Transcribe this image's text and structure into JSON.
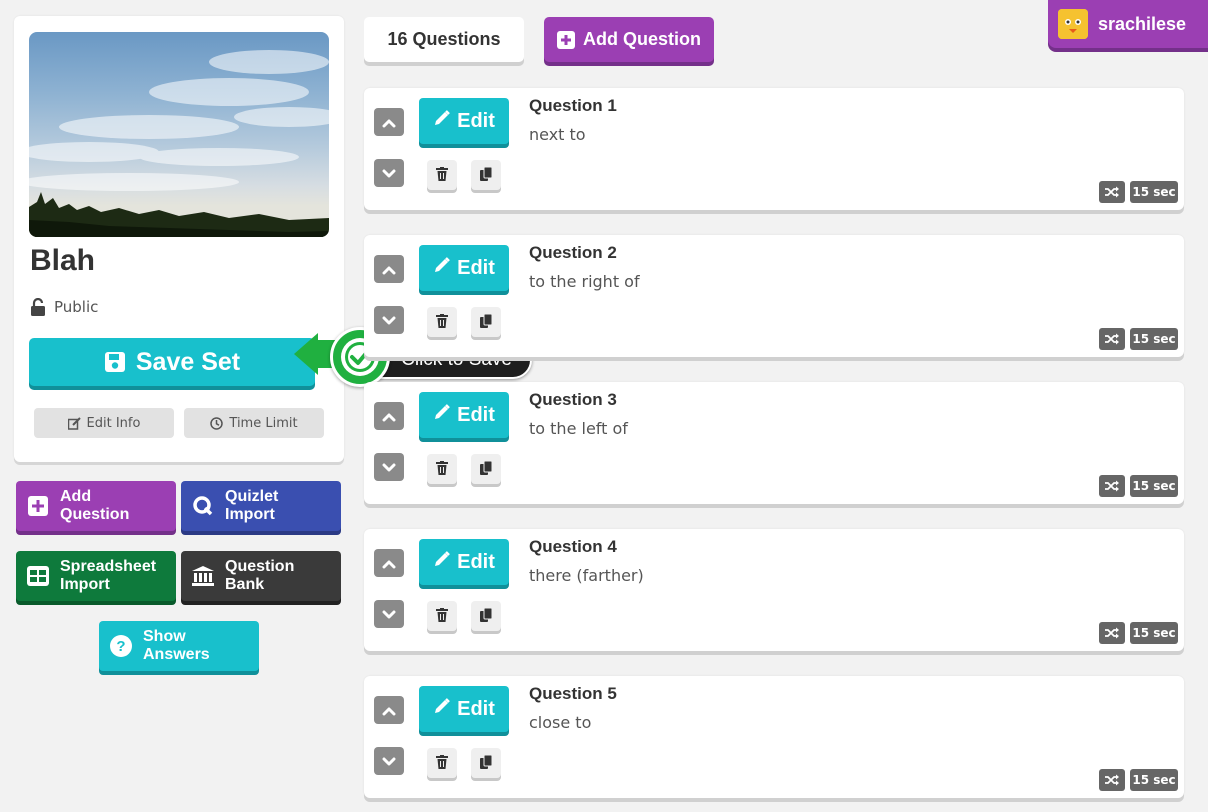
{
  "set": {
    "title": "Blah",
    "visibility": "Public",
    "save_label": "Save Set",
    "edit_info_label": "Edit Info",
    "time_limit_label": "Time Limit"
  },
  "tooltip": {
    "text": "Click to Save"
  },
  "actions": {
    "add_question": [
      "Add",
      "Question"
    ],
    "quizlet_import": [
      "Quizlet",
      "Import"
    ],
    "spreadsheet_import": [
      "Spreadsheet",
      "Import"
    ],
    "question_bank": [
      "Question",
      "Bank"
    ],
    "show_answers": [
      "Show",
      "Answers"
    ]
  },
  "topbar": {
    "count_label": "16 Questions",
    "add_question_label": "Add Question"
  },
  "user": {
    "name": "srachilese"
  },
  "questions": [
    {
      "title": "Question 1",
      "answer": "next to",
      "edit_label": "Edit",
      "time": "15 sec"
    },
    {
      "title": "Question 2",
      "answer": "to the right of",
      "edit_label": "Edit",
      "time": "15 sec"
    },
    {
      "title": "Question 3",
      "answer": "to the left of",
      "edit_label": "Edit",
      "time": "15 sec"
    },
    {
      "title": "Question 4",
      "answer": "there (farther)",
      "edit_label": "Edit",
      "time": "15 sec"
    },
    {
      "title": "Question 5",
      "answer": "close to",
      "edit_label": "Edit",
      "time": "15 sec"
    }
  ],
  "colors": {
    "teal": "#18c0cc",
    "purple": "#9b3fb3",
    "blue": "#3a4fb0",
    "green": "#0e7a3c",
    "dark": "#3a3a3a",
    "tooltip_green": "#20b040"
  }
}
